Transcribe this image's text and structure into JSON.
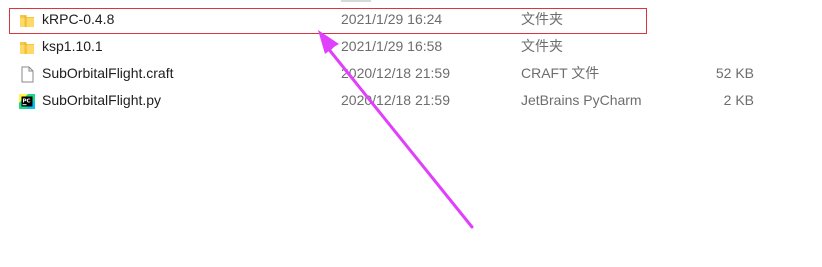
{
  "files": [
    {
      "name": "kRPC-0.4.8",
      "modified": "2021/1/29 16:24",
      "type": "文件夹",
      "size": "",
      "icon": "folder-icon"
    },
    {
      "name": "ksp1.10.1",
      "modified": "2021/1/29 16:58",
      "type": "文件夹",
      "size": "",
      "icon": "folder-icon"
    },
    {
      "name": "SubOrbitalFlight.craft",
      "modified": "2020/12/18 21:59",
      "type": "CRAFT 文件",
      "size": "52 KB",
      "icon": "document-icon"
    },
    {
      "name": "SubOrbitalFlight.py",
      "modified": "2020/12/18 21:59",
      "type": "JetBrains PyCharm",
      "size": "2 KB",
      "icon": "pycharm-icon"
    }
  ],
  "colors": {
    "highlight_border": "#d9363e",
    "arrow": "#e040fb",
    "folder": "#f5c744",
    "meta_text": "#6d6d6d"
  }
}
